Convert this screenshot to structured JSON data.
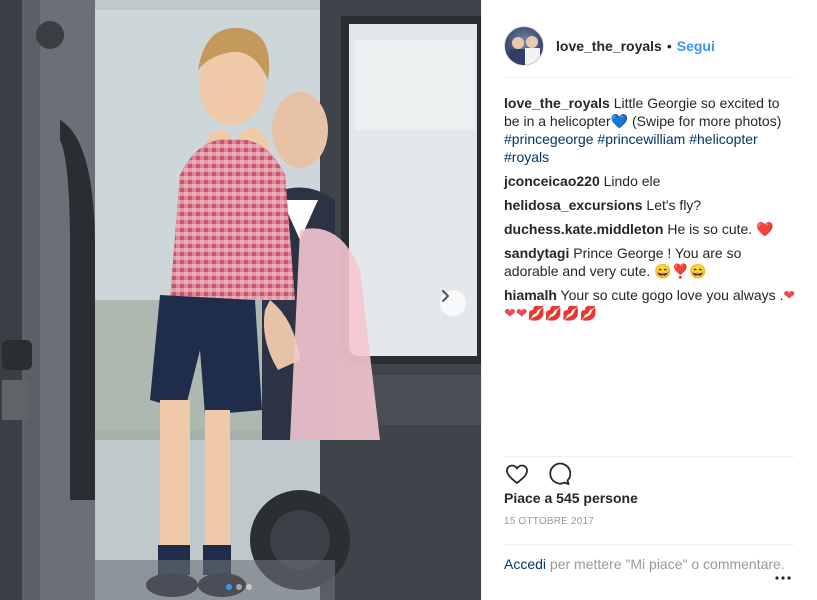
{
  "post": {
    "username": "love_the_royals",
    "separator": "•",
    "follow_label": "Segui"
  },
  "caption": {
    "username": "love_the_royals",
    "text_before": "Little Georgie so excited to be in a helicopter",
    "emoji": "💙",
    "text_after": " (Swipe for more photos) ",
    "hashtags": [
      "#princegeorge",
      "#princewilliam",
      "#helicopter",
      "#royals"
    ]
  },
  "comments": [
    {
      "username": "jconceicao220",
      "text": "Lindo ele"
    },
    {
      "username": "helidosa_excursions",
      "text": "Let's fly?"
    },
    {
      "username": "duchess.kate.middleton",
      "text": "He is so cute. ",
      "emoji": "❤️"
    },
    {
      "username": "sandytagi",
      "text": "Prince George ! You are so adorable and very cute. ",
      "emoji": "😄❣️😄"
    },
    {
      "username": "hiamalh",
      "text": "Your so cute gogo love you always .",
      "emoji": "❤❤❤💋💋💋💋"
    }
  ],
  "likes_label": "Piace a 545 persone",
  "date": "15 OTTOBRE 2017",
  "footer": {
    "login_label": "Accedi",
    "rest": " per mettere \"Mi piace\" o commentare."
  },
  "icons": {
    "like": "heart-outline-icon",
    "comment": "speech-bubble-icon",
    "more": "ellipsis-icon",
    "next": "chevron-right-icon"
  },
  "carousel": {
    "count": 3,
    "active": 0
  },
  "colors": {
    "accent": "#3897f0",
    "link": "#003569",
    "muted": "#999999",
    "border": "#efefef"
  }
}
